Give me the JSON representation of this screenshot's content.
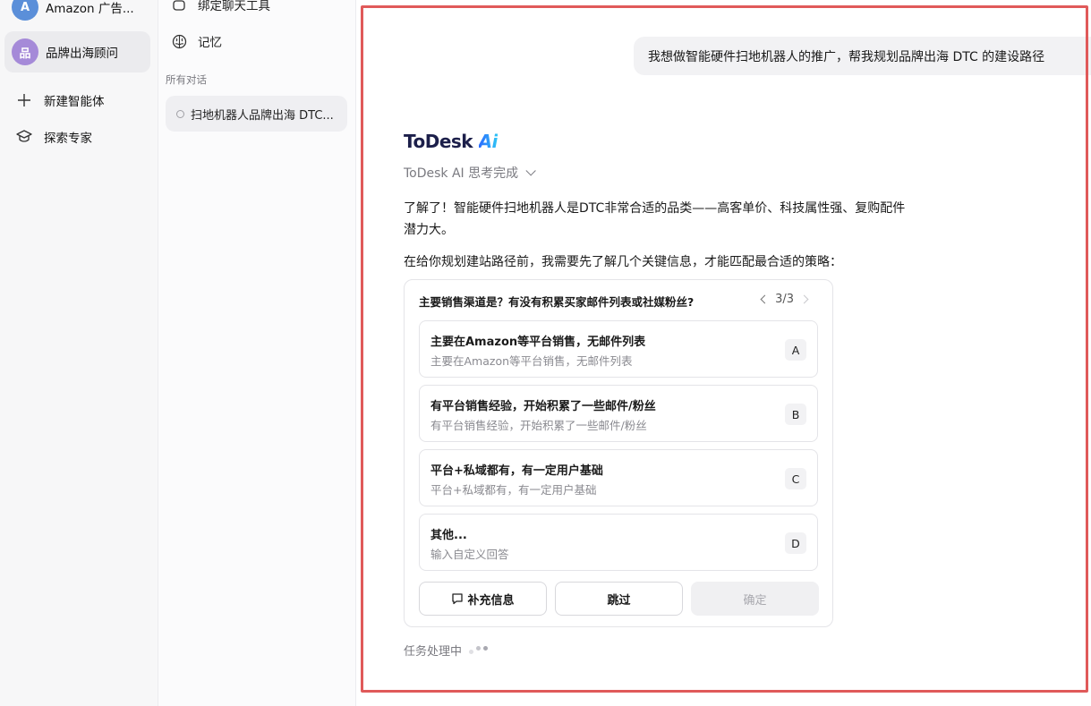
{
  "agents": [
    {
      "avatar": "A",
      "label": "Amazon 广告...",
      "color": "#5b8fd9"
    },
    {
      "avatar": "品",
      "label": "品牌出海顾问",
      "color": "#a58ad8"
    }
  ],
  "actions": {
    "new_agent": "新建智能体",
    "explore": "探索专家"
  },
  "mid_sidebar": {
    "bind_tool": "绑定聊天工具",
    "memory": "记忆",
    "section_title": "所有对话",
    "conversation": "扫地机器人品牌出海 DTC..."
  },
  "chat": {
    "user_message": "我想做智能硬件扫地机器人的推广，帮我规划品牌出海 DTC 的建设路径",
    "brand_name": "ToDesk",
    "brand_ai": "Ai",
    "thinking_status": "ToDesk AI 思考完成",
    "reply_line1": "了解了！智能硬件扫地机器人是DTC非常合适的品类——高客单价、科技属性强、复购配件",
    "reply_line2": "潜力大。",
    "reply_line3": "在给你规划建站路径前，我需要先了解几个关键信息，才能匹配最合适的策略："
  },
  "question": {
    "title": "主要销售渠道是？有没有积累买家邮件列表或社媒粉丝?",
    "pager": "3/3",
    "options": [
      {
        "key": "A",
        "title": "主要在Amazon等平台销售，无邮件列表",
        "sub": "主要在Amazon等平台销售，无邮件列表"
      },
      {
        "key": "B",
        "title": "有平台销售经验，开始积累了一些邮件/粉丝",
        "sub": "有平台销售经验，开始积累了一些邮件/粉丝"
      },
      {
        "key": "C",
        "title": "平台+私域都有，有一定用户基础",
        "sub": "平台+私域都有，有一定用户基础"
      },
      {
        "key": "D",
        "title": "其他...",
        "sub": "输入自定义回答"
      }
    ],
    "buttons": {
      "supplement": "补充信息",
      "skip": "跳过",
      "confirm": "确定"
    }
  },
  "status": {
    "text": "任务处理中"
  },
  "colors": {
    "highlight": "#e05a5a",
    "brand_dark": "#1c1f4a",
    "brand_ai_start": "#2b6bff",
    "brand_ai_end": "#2fc6f5"
  }
}
